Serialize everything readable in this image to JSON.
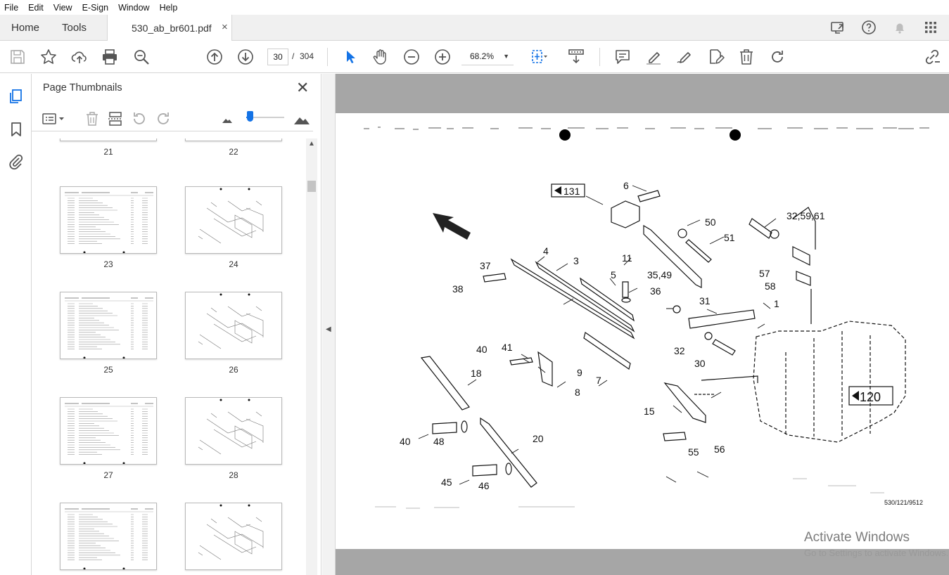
{
  "menu": [
    "File",
    "Edit",
    "View",
    "E-Sign",
    "Window",
    "Help"
  ],
  "tabs": {
    "home": "Home",
    "tools": "Tools",
    "document": "530_ab_br601.pdf",
    "close": "×"
  },
  "toolbar": {
    "current_page": "30",
    "page_separator": "/",
    "total_pages": "304",
    "zoom": "68.2%"
  },
  "panel": {
    "title": "Page Thumbnails",
    "close": "✕",
    "size_slider_fraction": 0.05
  },
  "thumbnails": [
    {
      "label": "21",
      "kind": "partial"
    },
    {
      "label": "22",
      "kind": "partial"
    },
    {
      "label": "23",
      "kind": "list"
    },
    {
      "label": "24",
      "kind": "drawing"
    },
    {
      "label": "25",
      "kind": "list"
    },
    {
      "label": "26",
      "kind": "drawing"
    },
    {
      "label": "27",
      "kind": "list"
    },
    {
      "label": "28",
      "kind": "drawing"
    },
    {
      "label": "",
      "kind": "list"
    },
    {
      "label": "",
      "kind": "drawing"
    }
  ],
  "drawing": {
    "callouts": [
      "6",
      "131",
      "50",
      "51",
      "32,59,61",
      "11",
      "4",
      "3",
      "37",
      "38",
      "5",
      "35,49",
      "36",
      "31",
      "1",
      "57",
      "58",
      "40",
      "41",
      "9",
      "8",
      "7",
      "18",
      "32",
      "30",
      "15",
      "120",
      "40",
      "48",
      "20",
      "55",
      "56",
      "45",
      "46"
    ],
    "figure_id": "530/121/9512"
  },
  "watermark": {
    "line1": "Activate Windows",
    "line2": "Go to Settings to activate Windows."
  },
  "colors": {
    "accent": "#1473e6",
    "chrome": "#f0f0f0",
    "doc_background": "#a6a6a6"
  },
  "icons": {
    "rail": [
      "pages-icon",
      "bookmark-icon",
      "attachment-icon"
    ]
  }
}
